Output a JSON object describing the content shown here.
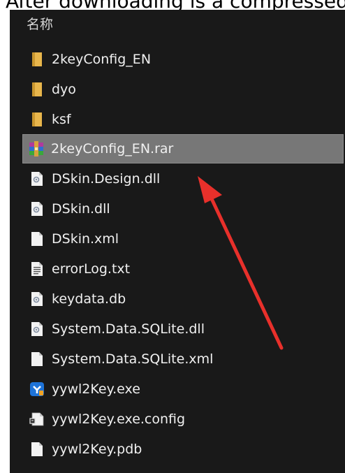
{
  "caption": "After downloading is a compressed",
  "column_header": "名称",
  "files": [
    {
      "name": "2keyConfig_EN",
      "icon": "folder-icon",
      "selected": false
    },
    {
      "name": "dyo",
      "icon": "folder-icon",
      "selected": false
    },
    {
      "name": "ksf",
      "icon": "folder-icon",
      "selected": false
    },
    {
      "name": "2keyConfig_EN.rar",
      "icon": "winrar-archive-icon",
      "selected": true
    },
    {
      "name": "DSkin.Design.dll",
      "icon": "dll-file-icon",
      "selected": false
    },
    {
      "name": "DSkin.dll",
      "icon": "dll-file-icon",
      "selected": false
    },
    {
      "name": "DSkin.xml",
      "icon": "blank-file-icon",
      "selected": false
    },
    {
      "name": "errorLog.txt",
      "icon": "text-file-icon",
      "selected": false
    },
    {
      "name": "keydata.db",
      "icon": "db-file-icon",
      "selected": false
    },
    {
      "name": "System.Data.SQLite.dll",
      "icon": "dll-file-icon",
      "selected": false
    },
    {
      "name": "System.Data.SQLite.xml",
      "icon": "blank-file-icon",
      "selected": false
    },
    {
      "name": "yywl2Key.exe",
      "icon": "exe-app-icon",
      "selected": false
    },
    {
      "name": "yywl2Key.exe.config",
      "icon": "config-file-icon",
      "selected": false
    },
    {
      "name": "yywl2Key.pdb",
      "icon": "blank-file-icon",
      "selected": false
    }
  ],
  "colors": {
    "background": "#191919",
    "selection": "#777777",
    "folder": "#e8b64c",
    "arrow": "#e8302b"
  }
}
